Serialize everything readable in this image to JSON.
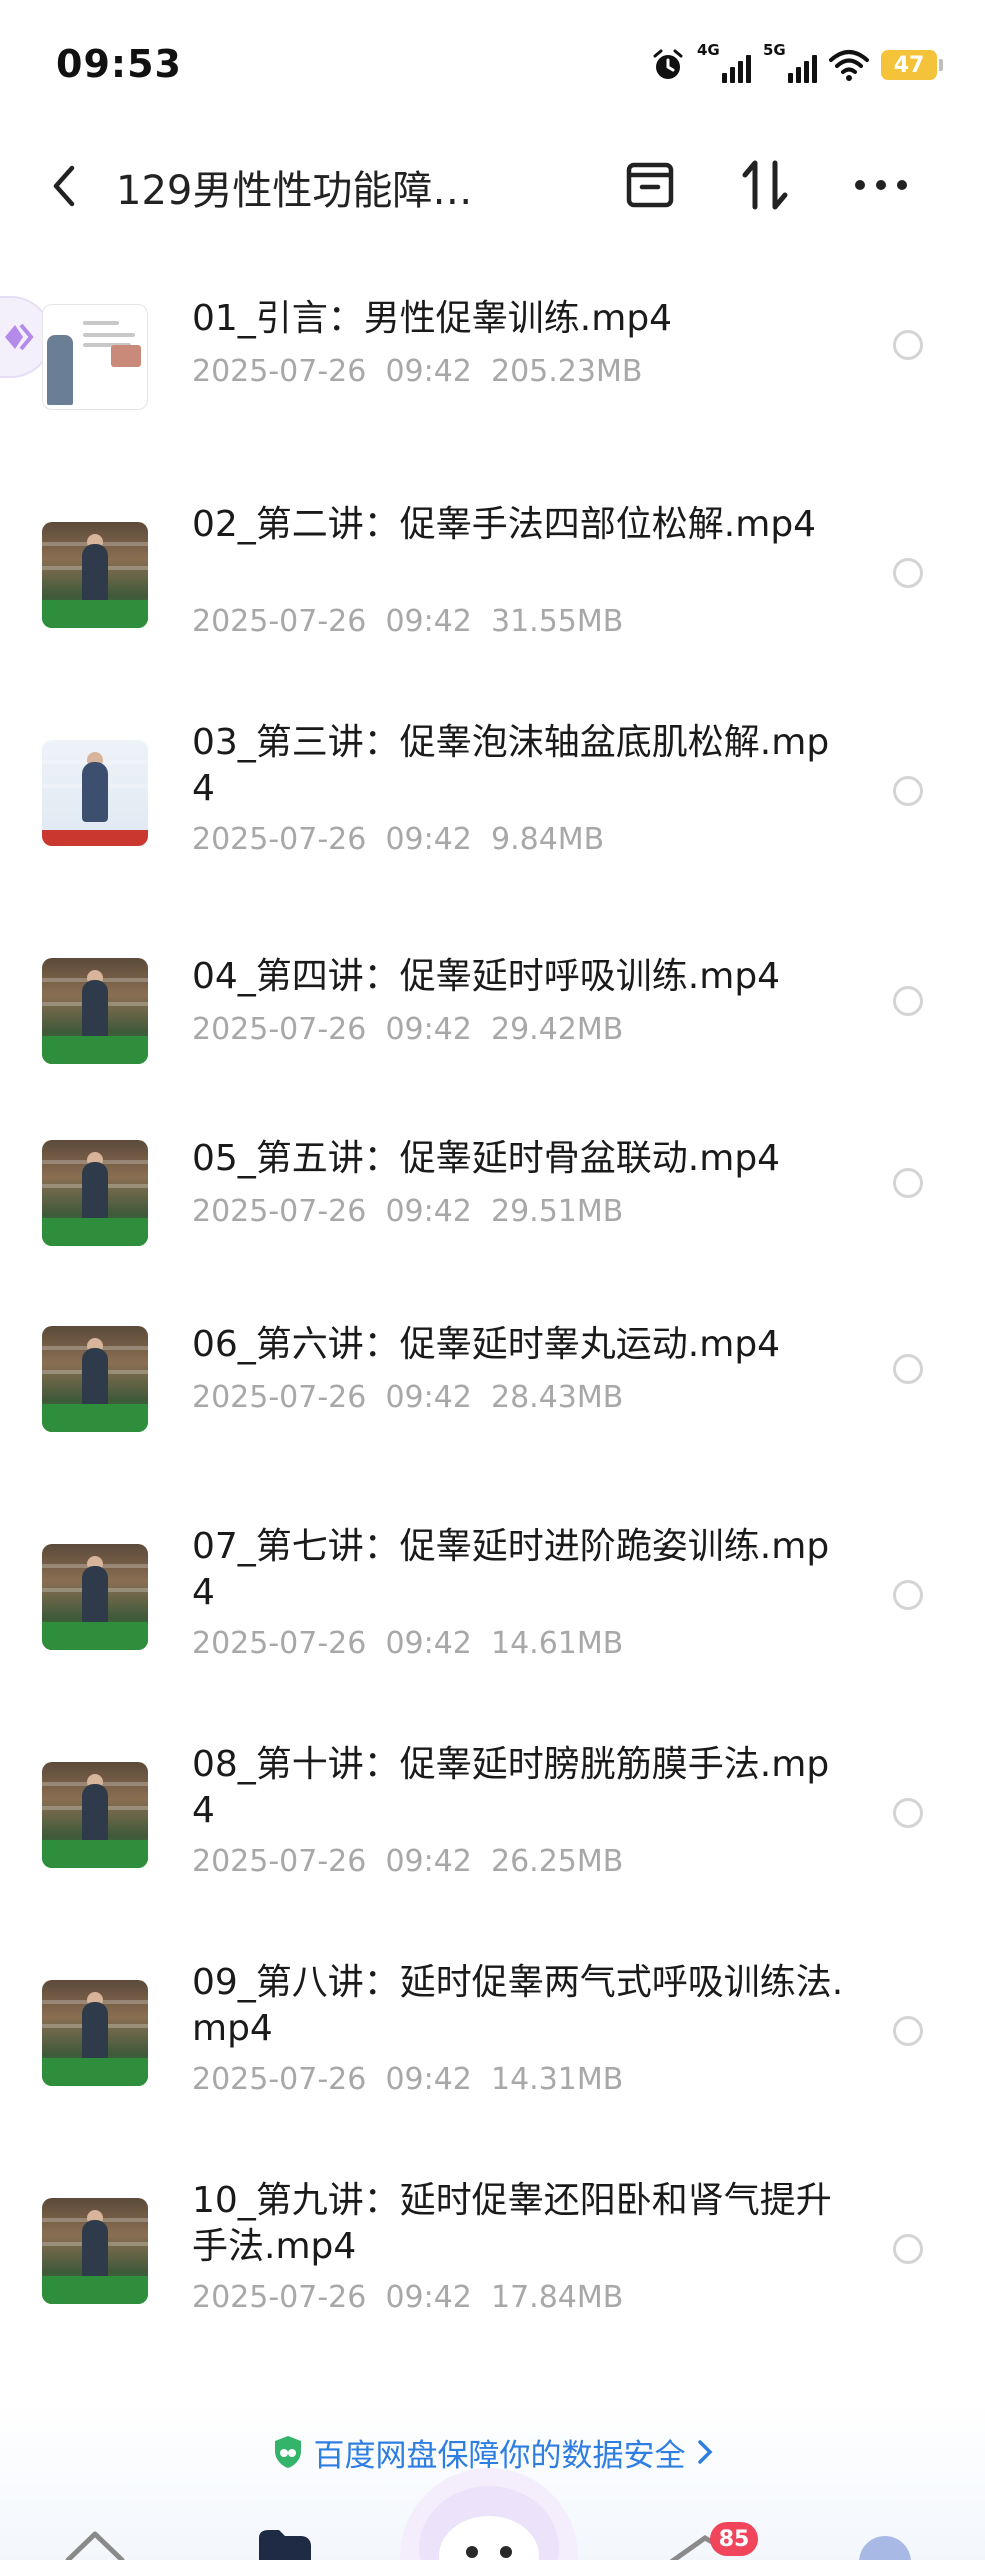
{
  "status_bar": {
    "time": "09:53",
    "sim1_label": "4G",
    "sim2_label": "5G",
    "battery": "47"
  },
  "nav": {
    "title": "129男性性功能障…",
    "icons": [
      "chevron-left-icon",
      "archive-icon",
      "sort-icon",
      "more-icon"
    ]
  },
  "files": [
    {
      "name": "01_引言：男性促睾训练.mp4",
      "date": "2025-07-26",
      "time": "09:42",
      "size": "205.23MB",
      "thumb": "doc"
    },
    {
      "name": "02_第二讲：促睾手法四部位松解.mp4",
      "date": "2025-07-26",
      "time": "09:42",
      "size": "31.55MB",
      "thumb": "studio"
    },
    {
      "name": "03_第三讲：促睾泡沫轴盆底肌松解.mp4",
      "date": "2025-07-26",
      "time": "09:42",
      "size": "9.84MB",
      "thumb": "light"
    },
    {
      "name": "04_第四讲：促睾延时呼吸训练.mp4",
      "date": "2025-07-26",
      "time": "09:42",
      "size": "29.42MB",
      "thumb": "studio"
    },
    {
      "name": "05_第五讲：促睾延时骨盆联动.mp4",
      "date": "2025-07-26",
      "time": "09:42",
      "size": "29.51MB",
      "thumb": "studio"
    },
    {
      "name": "06_第六讲：促睾延时睾丸运动.mp4",
      "date": "2025-07-26",
      "time": "09:42",
      "size": "28.43MB",
      "thumb": "studio"
    },
    {
      "name": "07_第七讲：促睾延时进阶跪姿训练.mp4",
      "date": "2025-07-26",
      "time": "09:42",
      "size": "14.61MB",
      "thumb": "studio"
    },
    {
      "name": "08_第十讲：促睾延时膀胱筋膜手法.mp4",
      "date": "2025-07-26",
      "time": "09:42",
      "size": "26.25MB",
      "thumb": "studio"
    },
    {
      "name": "09_第八讲：延时促睾两气式呼吸训练法.mp4",
      "date": "2025-07-26",
      "time": "09:42",
      "size": "14.31MB",
      "thumb": "studio"
    },
    {
      "name": "10_第九讲：延时促睾还阳卧和肾气提升手法.mp4",
      "date": "2025-07-26",
      "time": "09:42",
      "size": "17.84MB",
      "thumb": "studio"
    }
  ],
  "footer": {
    "security_text": "百度网盘保障你的数据安全",
    "badge_count": "85"
  },
  "colors": {
    "accent": "#2e7de1",
    "meta_text": "#a8a8a8",
    "badge": "#f0455b",
    "battery": "#f4c33a"
  }
}
